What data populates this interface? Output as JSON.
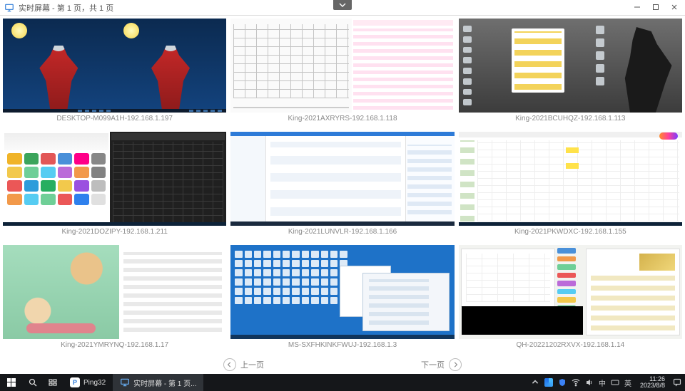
{
  "window": {
    "title": "实时屏幕 - 第 1 页，共 1 页"
  },
  "thumbnails": [
    {
      "label": "DESKTOP-M099A1H-192.168.1.197"
    },
    {
      "label": "King-2021AXRYRS-192.168.1.118"
    },
    {
      "label": "King-2021BCUHQZ-192.168.1.113"
    },
    {
      "label": "King-2021DOZIPY-192.168.1.211"
    },
    {
      "label": "King-2021LUNVLR-192.168.1.166"
    },
    {
      "label": "King-2021PKWDXC-192.168.1.155"
    },
    {
      "label": "King-2021YMRYNQ-192.168.1.17"
    },
    {
      "label": "MS-SXFHKINKFWUJ-192.168.1.3"
    },
    {
      "label": "QH-20221202RXVX-192.168.1.14"
    }
  ],
  "pagination": {
    "prev": "上一页",
    "next": "下一页"
  },
  "taskbar": {
    "app1": "Ping32",
    "app2": "实时屏幕 - 第 1 页...",
    "ime": "中",
    "ime2": "英",
    "time": "11:26",
    "date": "2023/8/8"
  }
}
